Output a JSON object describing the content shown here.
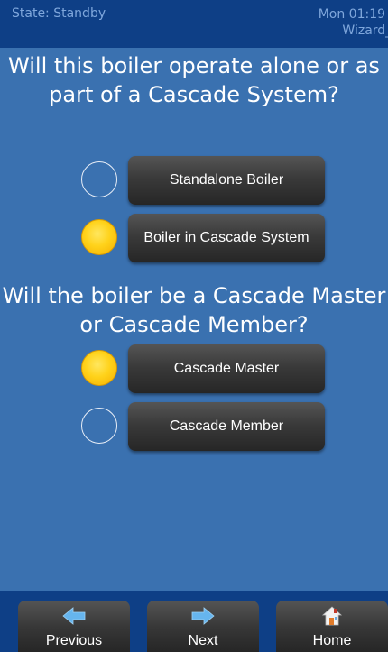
{
  "status": {
    "state": "State: Standby",
    "datetime": "Mon 01:19 PM",
    "screen": "Wizard_03"
  },
  "questions": {
    "q1": "Will this boiler operate alone or as part of a Cascade System?",
    "q2": "Will the boiler be a Cascade Master or Cascade Member?"
  },
  "group1": {
    "options": [
      {
        "label": "Standalone Boiler",
        "selected": false
      },
      {
        "label": "Boiler in Cascade System",
        "selected": true
      }
    ]
  },
  "group2": {
    "options": [
      {
        "label": "Cascade Master",
        "selected": true
      },
      {
        "label": "Cascade Member",
        "selected": false
      }
    ]
  },
  "nav": {
    "previous": {
      "label": "Previous",
      "icon": "arrow-left-icon"
    },
    "next": {
      "label": "Next",
      "icon": "arrow-right-icon"
    },
    "home": {
      "label": "Home",
      "icon": "home-icon"
    }
  },
  "colors": {
    "background": "#3a71b0",
    "bar": "#0e3f86",
    "status_text": "#7fa7dc",
    "radio_selected": "#ffd21a",
    "arrow": "#66b5ee"
  }
}
